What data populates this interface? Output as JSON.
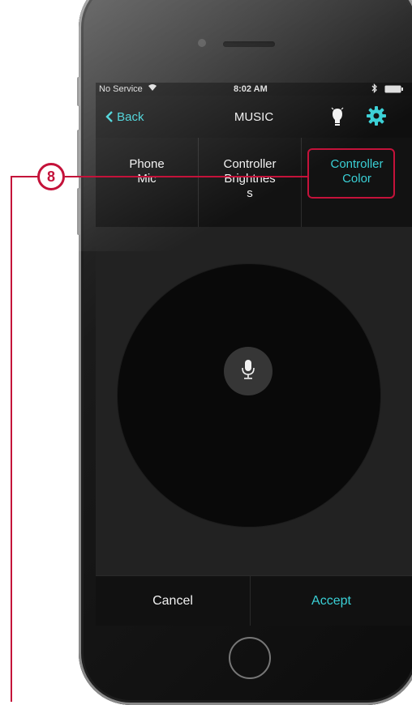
{
  "status_bar": {
    "carrier": "No Service",
    "time": "8:02 AM"
  },
  "nav": {
    "back_label": "Back",
    "title": "MUSIC"
  },
  "tabs": [
    {
      "label": "Phone\nMic"
    },
    {
      "label": "Controller\nBrightnes\ns"
    },
    {
      "label": "Controller\nColor"
    }
  ],
  "footer": {
    "cancel_label": "Cancel",
    "accept_label": "Accept"
  },
  "callout": {
    "number": "8"
  },
  "colors": {
    "accent": "#3ad0d6",
    "callout": "#c4123a",
    "background": "#202020"
  },
  "icons": [
    "wifi-icon",
    "bluetooth-icon",
    "battery-icon",
    "chevron-left-icon",
    "lightbulb-icon",
    "gear-icon",
    "microphone-icon"
  ]
}
